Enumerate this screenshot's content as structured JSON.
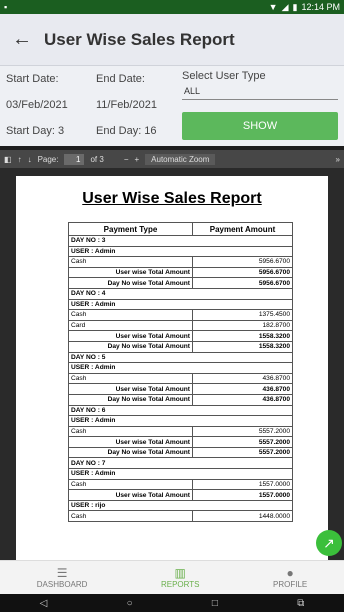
{
  "status": {
    "time": "12:14 PM",
    "left_icon": "notification-icon",
    "icons": [
      "wifi-icon",
      "signal-icon",
      "battery-icon"
    ]
  },
  "appbar": {
    "title": "User Wise Sales Report",
    "back_icon": "arrow-back-icon"
  },
  "filters": {
    "start_date_label": "Start Date:",
    "start_date": "03/Feb/2021",
    "start_day": "Start Day: 3",
    "end_date_label": "End Date:",
    "end_date": "11/Feb/2021",
    "end_day": "End Day: 16",
    "user_type_label": "Select User Type",
    "user_type_value": "ALL",
    "show_label": "SHOW"
  },
  "pdf_toolbar": {
    "page_label": "Page:",
    "page_value": "1",
    "page_of": "of 3",
    "minus": "−",
    "plus": "+",
    "zoom": "Automatic Zoom",
    "more": "»"
  },
  "report": {
    "title": "User Wise Sales Report",
    "headers": [
      "Payment Type",
      "Payment Amount"
    ],
    "rows": [
      {
        "t": "day",
        "a": "DAY NO : 3",
        "b": ""
      },
      {
        "t": "user",
        "a": "USER : Admin",
        "b": ""
      },
      {
        "t": "row",
        "a": "Cash",
        "b": "5956.6700"
      },
      {
        "t": "sub",
        "a": "User wise Total Amount",
        "b": "5956.6700"
      },
      {
        "t": "sub",
        "a": "Day No wise Total Amount",
        "b": "5956.6700"
      },
      {
        "t": "day",
        "a": "DAY NO : 4",
        "b": ""
      },
      {
        "t": "user",
        "a": "USER : Admin",
        "b": ""
      },
      {
        "t": "row",
        "a": "Cash",
        "b": "1375.4500"
      },
      {
        "t": "row",
        "a": "Card",
        "b": "182.8700"
      },
      {
        "t": "sub",
        "a": "User wise Total Amount",
        "b": "1558.3200"
      },
      {
        "t": "sub",
        "a": "Day No wise Total Amount",
        "b": "1558.3200"
      },
      {
        "t": "day",
        "a": "DAY NO : 5",
        "b": ""
      },
      {
        "t": "user",
        "a": "USER : Admin",
        "b": ""
      },
      {
        "t": "row",
        "a": "Cash",
        "b": "436.8700"
      },
      {
        "t": "sub",
        "a": "User wise Total Amount",
        "b": "436.8700"
      },
      {
        "t": "sub",
        "a": "Day No wise Total Amount",
        "b": "436.8700"
      },
      {
        "t": "day",
        "a": "DAY NO : 6",
        "b": ""
      },
      {
        "t": "user",
        "a": "USER : Admin",
        "b": ""
      },
      {
        "t": "row",
        "a": "Cash",
        "b": "5557.2000"
      },
      {
        "t": "sub",
        "a": "User wise Total Amount",
        "b": "5557.2000"
      },
      {
        "t": "sub",
        "a": "Day No wise Total Amount",
        "b": "5557.2000"
      },
      {
        "t": "day",
        "a": "DAY NO : 7",
        "b": ""
      },
      {
        "t": "user",
        "a": "USER : Admin",
        "b": ""
      },
      {
        "t": "row",
        "a": "Cash",
        "b": "1557.0000"
      },
      {
        "t": "sub",
        "a": "User wise Total Amount",
        "b": "1557.0000"
      },
      {
        "t": "user",
        "a": "USER : rijo",
        "b": ""
      },
      {
        "t": "row",
        "a": "Cash",
        "b": "1448.0000"
      }
    ]
  },
  "nav": {
    "dashboard": "DASHBOARD",
    "reports": "REPORTS",
    "profile": "PROFILE"
  },
  "colors": {
    "accent": "#5cb85c",
    "statusbar": "#1b5e20",
    "active_nav": "#6ab04c"
  }
}
